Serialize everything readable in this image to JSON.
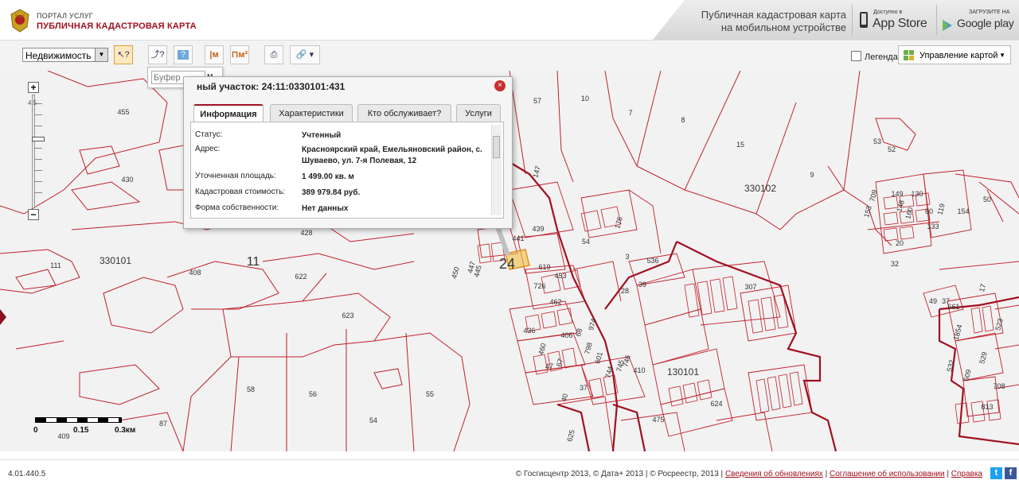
{
  "header": {
    "portal_small": "ПОРТАЛ УСЛУГ",
    "portal_title": "ПУБЛИЧНАЯ КАДАСТРОВАЯ КАРТА",
    "promo_line1": "Публичная кадастровая карта",
    "promo_line2": "на мобильном устройстве",
    "appstore_small": "Доступно в",
    "appstore_big": "App Store",
    "googleplay_small": "ЗАГРУЗИТЕ НА",
    "googleplay_big": "Google play"
  },
  "toolbar": {
    "object_type": "Недвижимость",
    "legend_label": "Легенда",
    "map_manager_label": "Управление картой"
  },
  "buffer": {
    "placeholder": "Буфер",
    "unit": "м."
  },
  "zoom": {
    "plus": "+",
    "minus": "−",
    "top_label": "4.5"
  },
  "popup": {
    "title": "ный участок: 24:11:0330101:431",
    "close": "×",
    "tabs": [
      "Информация",
      "Характеристики",
      "Кто обслуживает?",
      "Услуги"
    ],
    "fields": [
      {
        "label": "Статус:",
        "value": "Учтенный"
      },
      {
        "label": "Адрес:",
        "value": "Красноярский край, Емельяновский район, с. Шуваево, ул. 7-я Полевая, 12"
      },
      {
        "label": "Уточненная площадь:",
        "value": "1 499.00 кв. м"
      },
      {
        "label": "Кадастровая стоимость:",
        "value": "389 979.84 руб."
      },
      {
        "label": "Форма собственности:",
        "value": "Нет данных"
      }
    ]
  },
  "scale": [
    "0",
    "0.15",
    "0.3км"
  ],
  "map_labels": [
    {
      "t": "455"
    },
    {
      "t": "430"
    },
    {
      "t": "111"
    },
    {
      "t": "330101"
    },
    {
      "t": "11"
    },
    {
      "t": "408"
    },
    {
      "t": "428"
    },
    {
      "t": "622"
    },
    {
      "t": "623"
    },
    {
      "t": "58"
    },
    {
      "t": "56"
    },
    {
      "t": "55"
    },
    {
      "t": "54"
    },
    {
      "t": "87"
    },
    {
      "t": "409"
    },
    {
      "t": "57"
    },
    {
      "t": "10"
    },
    {
      "t": "7"
    },
    {
      "t": "8"
    },
    {
      "t": "15"
    },
    {
      "t": "9"
    },
    {
      "t": "330102"
    },
    {
      "t": "52"
    },
    {
      "t": "53"
    },
    {
      "t": "50"
    },
    {
      "t": "441"
    },
    {
      "t": "439"
    },
    {
      "t": "54"
    },
    {
      "t": "24"
    },
    {
      "t": "619"
    },
    {
      "t": "453"
    },
    {
      "t": "726"
    },
    {
      "t": "462"
    },
    {
      "t": "536"
    },
    {
      "t": "307"
    },
    {
      "t": "436"
    },
    {
      "t": "460"
    },
    {
      "t": "130101"
    },
    {
      "t": "410"
    },
    {
      "t": "37"
    },
    {
      "t": "475"
    },
    {
      "t": "624"
    },
    {
      "t": "17"
    },
    {
      "t": "20"
    },
    {
      "t": "133"
    },
    {
      "t": "32"
    },
    {
      "t": "149"
    },
    {
      "t": "148"
    },
    {
      "t": "176"
    },
    {
      "t": "147"
    },
    {
      "t": "1854"
    },
    {
      "t": "523"
    },
    {
      "t": "509"
    },
    {
      "t": "529"
    },
    {
      "t": "532"
    },
    {
      "t": "708"
    },
    {
      "t": "813"
    },
    {
      "t": "49"
    },
    {
      "t": "37"
    },
    {
      "t": "661"
    },
    {
      "t": "28"
    },
    {
      "t": "39"
    },
    {
      "t": "625"
    },
    {
      "t": "40"
    },
    {
      "t": "47"
    },
    {
      "t": "67"
    },
    {
      "t": "406"
    },
    {
      "t": "68"
    },
    {
      "t": "974"
    },
    {
      "t": "798"
    },
    {
      "t": "601"
    },
    {
      "t": "744"
    },
    {
      "t": "745"
    },
    {
      "t": "746"
    },
    {
      "t": "445"
    },
    {
      "t": "447"
    },
    {
      "t": "450"
    },
    {
      "t": "709"
    },
    {
      "t": "153"
    },
    {
      "t": "160"
    },
    {
      "t": "130"
    },
    {
      "t": "60"
    },
    {
      "t": "119"
    },
    {
      "t": "154"
    },
    {
      "t": "3"
    }
  ],
  "footer": {
    "version": "4.01.440.5",
    "copyright": "© Госгисцентр 2013, © Дата+ 2013 | © Росреестр, 2013 |",
    "link_updates": "Сведения об обновлениях",
    "link_terms": "Соглашение об использовании",
    "link_help": "Справка",
    "twitter": "t",
    "facebook": "f"
  },
  "colors": {
    "brand": "#a01020",
    "parcel_line": "#c0202a",
    "district_line": "#a01020",
    "map_bg": "#f2f2f2"
  }
}
